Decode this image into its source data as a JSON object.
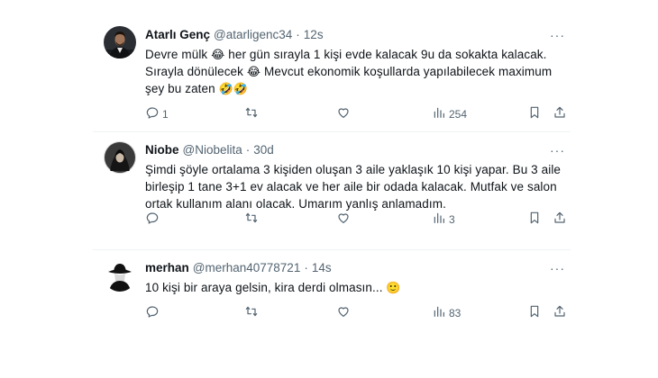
{
  "tweets": [
    {
      "name": "Atarlı Genç",
      "handle": "@atarligenc34",
      "time": "12s",
      "body": [
        {
          "text": "Devre mülk "
        },
        {
          "emoji": "😂"
        },
        {
          "text": " her gün sırayla 1 kişi evde kalacak 9u da sokakta kalacak."
        },
        {
          "br": true
        },
        {
          "text": "Sırayla dönülecek "
        },
        {
          "emoji": "😂"
        },
        {
          "text": " Mevcut ekonomik koşullarda yapılabilecek maximum"
        },
        {
          "br": true
        },
        {
          "text": "şey bu zaten "
        },
        {
          "emoji": "🤣🤣"
        }
      ],
      "reply_count": "1",
      "retweet_count": "",
      "like_count": "",
      "view_count": "254"
    },
    {
      "name": "Niobe",
      "handle": "@Niobelita",
      "time": "30d",
      "body": [
        {
          "text": "Şimdi şöyle ortalama 3 kişiden oluşan 3 aile yaklaşık 10 kişi yapar. Bu 3 aile"
        },
        {
          "br": true
        },
        {
          "text": "birleşip 1 tane 3+1 ev alacak ve her aile bir odada kalacak. Mutfak ve salon"
        },
        {
          "br": true
        },
        {
          "text": "ortak kullanım alanı olacak. Umarım yanlış anlamadım."
        }
      ],
      "reply_count": "",
      "retweet_count": "",
      "like_count": "",
      "view_count": "3"
    },
    {
      "name": "merhan",
      "handle": "@merhan40778721",
      "time": "14s",
      "body": [
        {
          "text": "10 kişi bir araya gelsin, kira derdi olmasın... "
        },
        {
          "emoji": "🙂"
        }
      ],
      "reply_count": "",
      "retweet_count": "",
      "like_count": "",
      "view_count": "83"
    }
  ],
  "separator": "·",
  "more_label": "···",
  "icons": {
    "reply": "reply-icon",
    "retweet": "retweet-icon",
    "like": "heart-icon",
    "views": "views-icon",
    "bookmark": "bookmark-icon",
    "share": "share-icon"
  },
  "colors": {
    "text": "#0f1419",
    "secondary": "#536471",
    "divider": "#eff3f4"
  }
}
